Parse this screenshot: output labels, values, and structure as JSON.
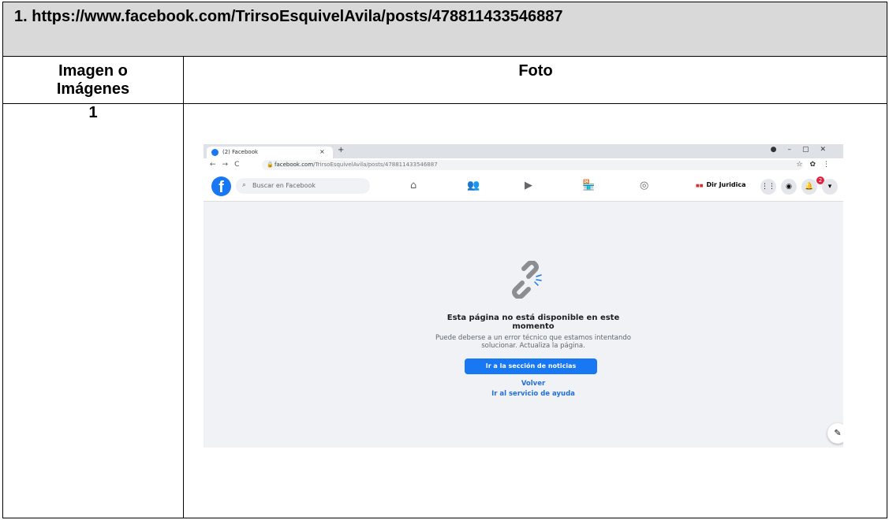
{
  "header": {
    "title": "1. https://www.facebook.com/TrirsoEsquivelAvila/posts/478811433546887"
  },
  "columns": {
    "left_line1": "Imagen o",
    "left_line2": "Imágenes",
    "right": "Foto"
  },
  "row1": {
    "number": "1"
  },
  "screenshot": {
    "tab_title": "(2) Facebook",
    "tab_close": "×",
    "new_tab": "+",
    "url_domain": "facebook.com",
    "url_path": "/TrirsoEsquivelAvila/posts/478811433546887",
    "search_placeholder": "Buscar en Facebook",
    "profile_name": "Dir Juridica",
    "notification_count": "2",
    "error": {
      "title_line1": "Esta página no está disponible en este",
      "title_line2": "momento",
      "subtitle_line1": "Puede deberse a un error técnico que estamos intentando",
      "subtitle_line2": "solucionar. Actualiza la página.",
      "primary_button": "Ir a la sección de noticias",
      "back_link": "Volver",
      "help_link": "Ir al servicio de ayuda"
    },
    "colors": {
      "facebook_blue": "#1877f2",
      "link_blue": "#216fdb",
      "page_bg": "#f0f2f5",
      "badge_red": "#e41e3f"
    }
  }
}
